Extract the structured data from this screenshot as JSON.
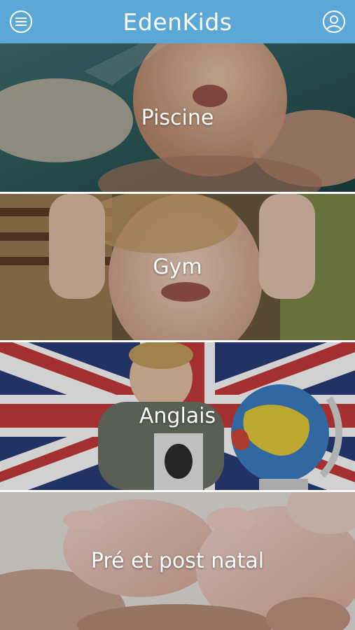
{
  "header": {
    "title": "EdenKids",
    "menu_icon": "hamburger-menu-icon",
    "profile_icon": "user-profile-icon",
    "color": "#5aa7d8"
  },
  "tiles": [
    {
      "label": "Piscine"
    },
    {
      "label": "Gym"
    },
    {
      "label": "Anglais"
    },
    {
      "label": "Pré et post natal"
    }
  ]
}
